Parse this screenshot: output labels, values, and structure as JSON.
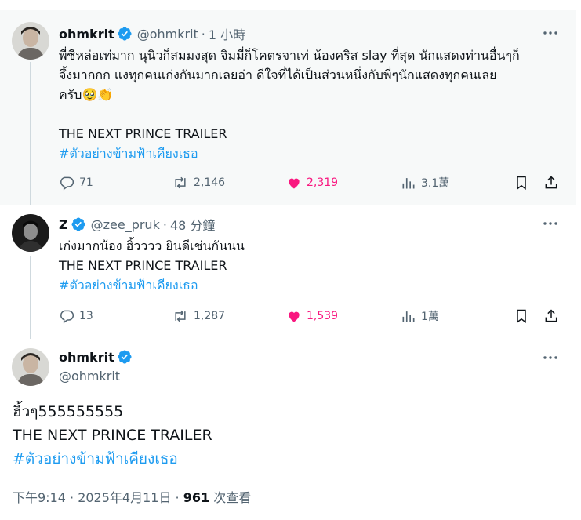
{
  "tweets": [
    {
      "name": "ohmkrit",
      "handle": "@ohmkrit",
      "dot": "·",
      "time": "1 小時",
      "lines": [
        "พี่ซีหล่อเท่มาก นุนิวก็สมมงสุด จิมมี่ก็โคตรจาเท่ น้องคริส slay ที่สุด นักแสดงท่านอื่นๆก็",
        "จึ้งมากกก แงทุกคนเก่งกันมากเลยอ่า ดีใจที่ได้เป็นส่วนหนึ่งกับพี่ๆนักแสดงทุกคนเลย",
        "ครับ🥹👏",
        "",
        "THE NEXT PRINCE TRAILER"
      ],
      "hashtag": "#ตัวอย่างข้ามฟ้าเคียงเธอ",
      "replies": "71",
      "retweets": "2,146",
      "likes": "2,319",
      "views": "3.1萬"
    },
    {
      "name": "Z",
      "handle": "@zee_pruk",
      "dot": "·",
      "time": "48 分鐘",
      "lines": [
        "เก่งมากน้อง ฮิ้วววว ยินดีเช่นกันนน",
        "THE NEXT PRINCE TRAILER"
      ],
      "hashtag": "#ตัวอย่างข้ามฟ้าเคียงเธอ",
      "replies": "13",
      "retweets": "1,287",
      "likes": "1,539",
      "views": "1萬"
    }
  ],
  "main": {
    "name": "ohmkrit",
    "handle": "@ohmkrit",
    "lines": [
      "ฮิ้วๆ555555555",
      "THE NEXT PRINCE TRAILER"
    ],
    "hashtag": "#ตัวอย่างข้ามฟ้าเคียงเธอ",
    "time": "下午9:14 · 2025年4月11日 · ",
    "views_count": "961",
    "views_label": " 次查看"
  },
  "colors": {
    "accent": "#1d9bf0",
    "like": "#f91880",
    "muted": "#536471",
    "highlight_bg": "#f7f9f9"
  },
  "icons": [
    "verified-badge-icon",
    "more-icon",
    "reply-icon",
    "retweet-icon",
    "heart-icon",
    "views-icon",
    "bookmark-icon",
    "share-icon"
  ]
}
